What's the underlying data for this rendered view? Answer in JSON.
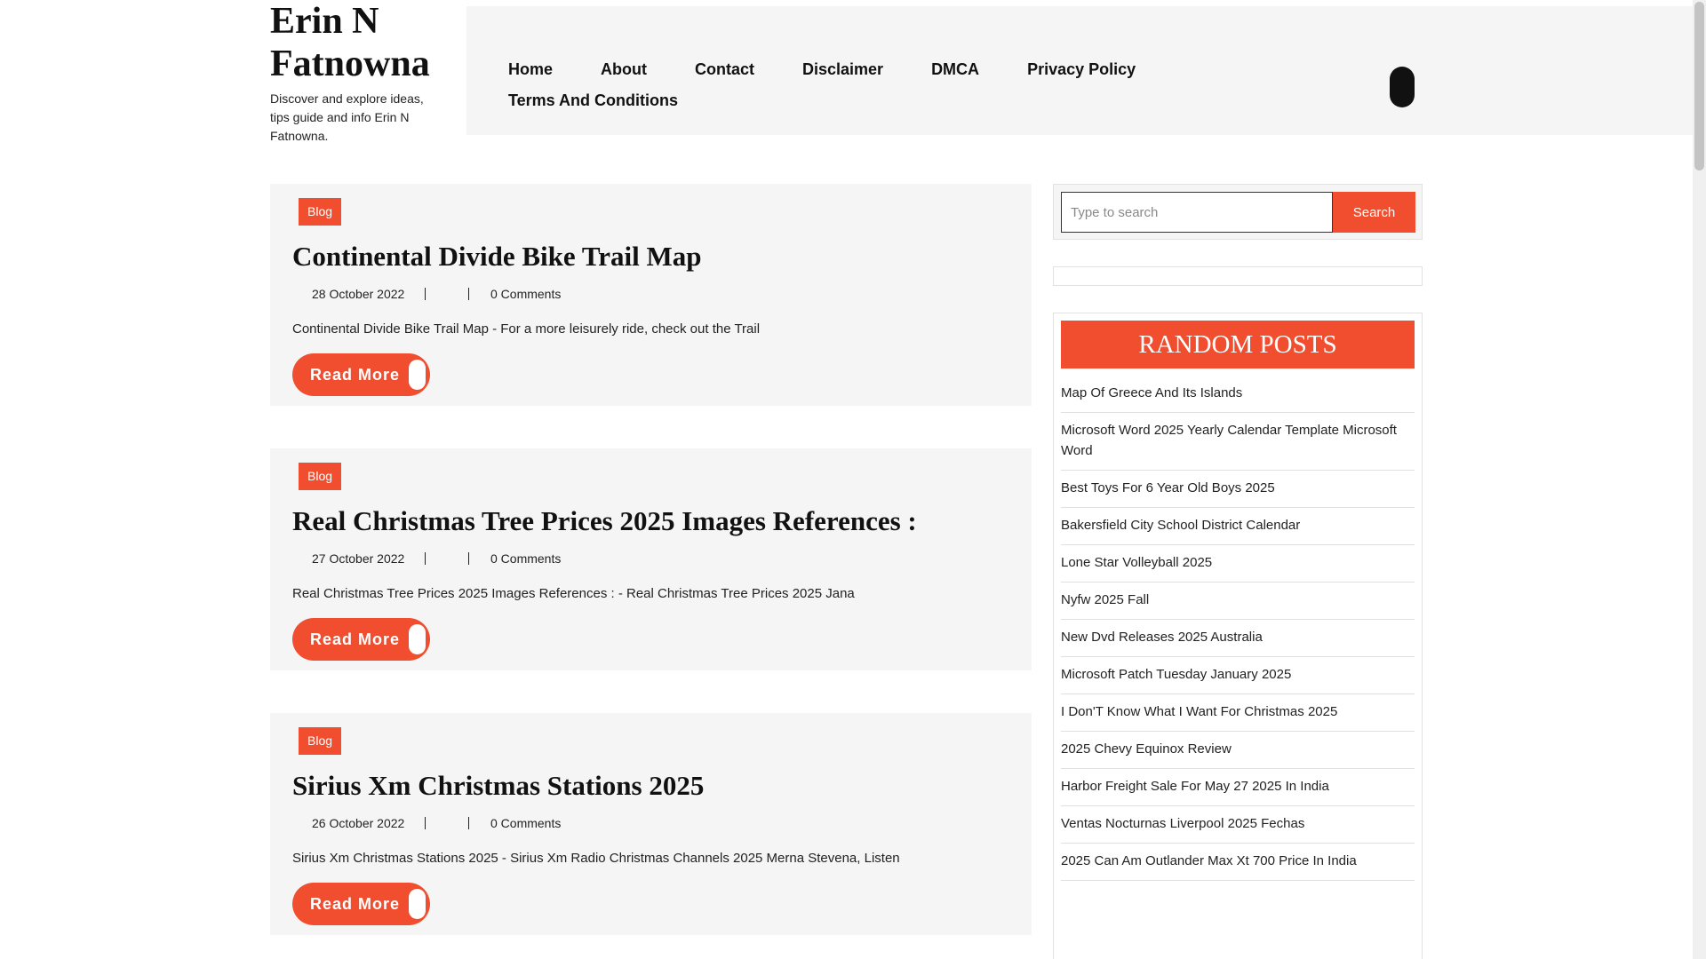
{
  "site": {
    "title": "Erin N Fatnowna",
    "description": "Discover and explore ideas, tips guide and info Erin N Fatnowna."
  },
  "nav": {
    "items": [
      "Home",
      "About",
      "Contact",
      "Disclaimer",
      "DMCA",
      "Privacy Policy",
      "Terms And Conditions"
    ]
  },
  "posts": [
    {
      "category": "Blog",
      "title": "Continental Divide Bike Trail Map",
      "date": "28 October 2022",
      "comments": "0 Comments",
      "excerpt": "Continental Divide Bike Trail Map - For a more leisurely ride, check out the Trail",
      "read_more": "Read More"
    },
    {
      "category": "Blog",
      "title": "Real Christmas Tree Prices 2025 Images References :",
      "date": "27 October 2022",
      "comments": "0 Comments",
      "excerpt": "Real Christmas Tree Prices 2025 Images References : - Real Christmas Tree Prices 2025 Jana",
      "read_more": "Read More"
    },
    {
      "category": "Blog",
      "title": "Sirius Xm Christmas Stations 2025",
      "date": "26 October 2022",
      "comments": "0 Comments",
      "excerpt": "Sirius Xm Christmas Stations 2025 - Sirius Xm Radio Christmas Channels 2025 Merna Stevena, Listen",
      "read_more": "Read More"
    }
  ],
  "search": {
    "placeholder": "Type to search",
    "button": "Search"
  },
  "random_posts": {
    "heading": "RANDOM POSTS",
    "items": [
      "Map Of Greece And Its Islands",
      "Microsoft Word 2025 Yearly Calendar Template Microsoft Word",
      "Best Toys For 6 Year Old Boys 2025",
      "Bakersfield City School District Calendar",
      "Lone Star Volleyball 2025",
      "Nyfw 2025 Fall",
      "New Dvd Releases 2025 Australia",
      "Microsoft Patch Tuesday January 2025",
      "I Don'T Know What I Want For Christmas 2025",
      "2025 Chevy Equinox Review",
      "Harbor Freight Sale For May 27 2025 In India",
      "Ventas Nocturnas Liverpool 2025 Fechas",
      "2025 Can Am Outlander Max Xt 700 Price In India"
    ]
  },
  "colors": {
    "accent": "#f04e2e",
    "panel": "#f5f5f5"
  }
}
